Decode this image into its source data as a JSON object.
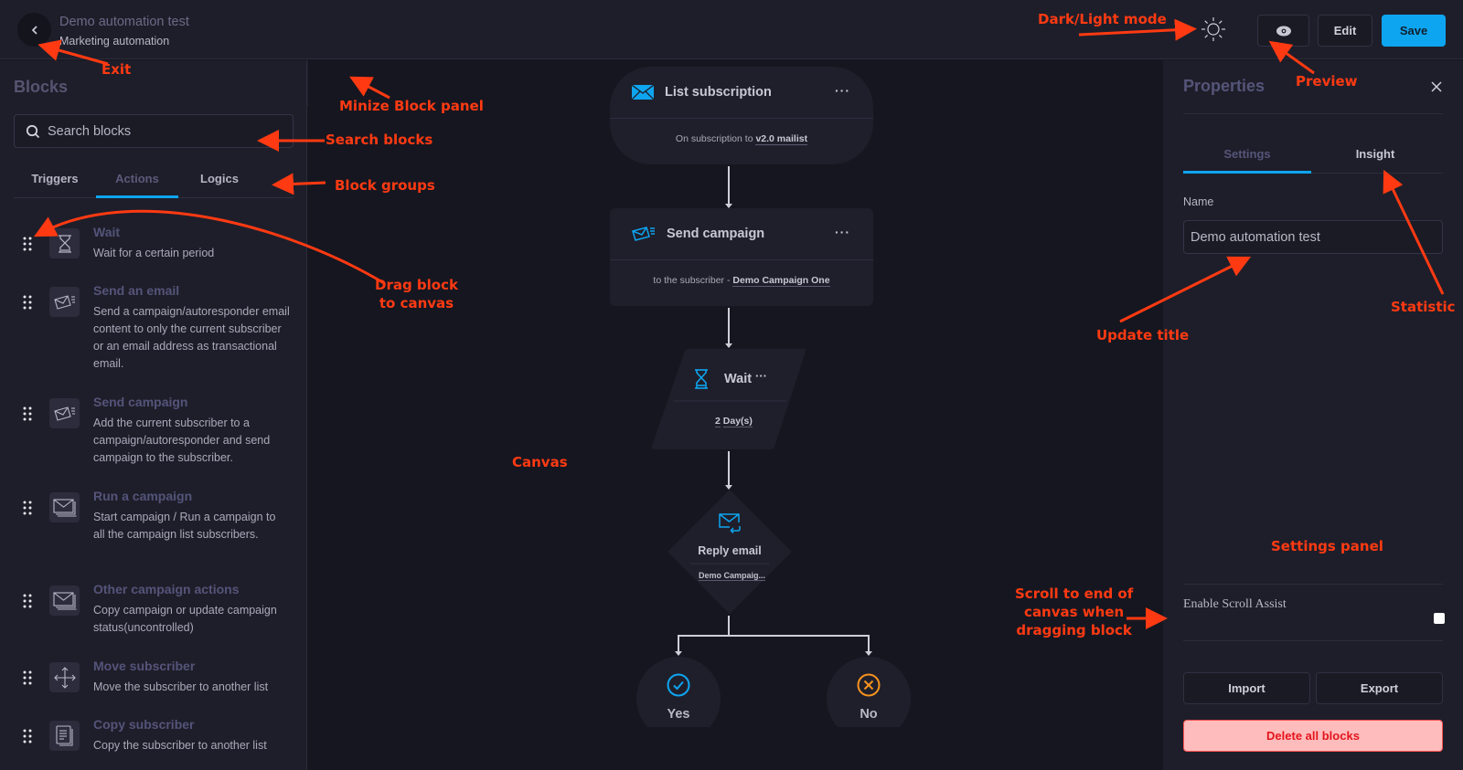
{
  "header": {
    "title": "Demo automation test",
    "subtitle": "Marketing automation",
    "preview_icon": "eye-icon",
    "edit_label": "Edit",
    "save_label": "Save",
    "theme_icon": "sun-icon",
    "back_icon": "chevron-left-icon"
  },
  "blocks_panel": {
    "title": "Blocks",
    "search_placeholder": "Search blocks",
    "collapse_icon": "chevrons-left-icon",
    "tabs": [
      {
        "label": "Triggers",
        "active": false
      },
      {
        "label": "Actions",
        "active": true
      },
      {
        "label": "Logics",
        "active": false
      }
    ],
    "items": [
      {
        "name": "Wait",
        "desc": "Wait for a certain period",
        "icon": "hourglass-icon"
      },
      {
        "name": "Send an email",
        "desc": "Send a campaign/autoresponder email content to only the current subscriber or an email address as transactional email.",
        "icon": "send-mail-icon"
      },
      {
        "name": "Send campaign",
        "desc": "Add the current subscriber to a campaign/autoresponder and send campaign to the subscriber.",
        "icon": "send-mail-icon"
      },
      {
        "name": "Run a campaign",
        "desc": "Start campaign / Run a campaign to all the campaign list subscribers.",
        "icon": "stacked-mail-icon"
      },
      {
        "name": "Other campaign actions",
        "desc": "Copy campaign or update campaign status(uncontrolled)",
        "icon": "stacked-mail-icon"
      },
      {
        "name": "Move subscriber",
        "desc": "Move the subscriber to another list",
        "icon": "move-arrows-icon"
      },
      {
        "name": "Copy subscriber",
        "desc": "Copy the subscriber to another list",
        "icon": "copy-document-icon"
      }
    ]
  },
  "canvas": {
    "nodes": {
      "list_subscription": {
        "title": "List subscription",
        "body_prefix": "On subscription to ",
        "body_value": "v2.0 mailist",
        "more": "···"
      },
      "send_campaign": {
        "title": "Send campaign",
        "body_prefix": "to the subscriber - ",
        "body_value": "Demo Campaign One",
        "more": "···"
      },
      "wait": {
        "title": "Wait",
        "amount": "2",
        "unit": "Day(s)",
        "more": "···"
      },
      "reply_email": {
        "title": "Reply email",
        "body_value": "Demo Campaig..."
      },
      "yes": {
        "label": "Yes"
      },
      "no": {
        "label": "No"
      }
    }
  },
  "properties": {
    "title": "Properties",
    "tabs": [
      {
        "label": "Settings",
        "active": true
      },
      {
        "label": "Insight",
        "active": false
      }
    ],
    "name_label": "Name",
    "name_value": "Demo automation test",
    "scroll_assist_label": "Enable Scroll Assist",
    "scroll_assist_checked": false,
    "import_label": "Import",
    "export_label": "Export",
    "delete_label": "Delete all blocks"
  },
  "annotations": {
    "exit": "Exit",
    "dark_light": "Dark/Light mode",
    "preview": "Preview",
    "minimize": "Minize Block panel",
    "search": "Search blocks",
    "groups": "Block groups",
    "drag_line1": "Drag block",
    "drag_line2": "to canvas",
    "canvas": "Canvas",
    "update_title": "Update title",
    "statistic": "Statistic",
    "settings_panel": "Settings panel",
    "scroll_line1": "Scroll to end of",
    "scroll_line2": "canvas when",
    "scroll_line3": "dragging block"
  },
  "colors": {
    "accent": "#0ea5f0",
    "annotation": "#ff3a12",
    "danger_bg": "#ffbcbc",
    "danger_text": "#e4141c",
    "no_branch": "#f5921e"
  }
}
